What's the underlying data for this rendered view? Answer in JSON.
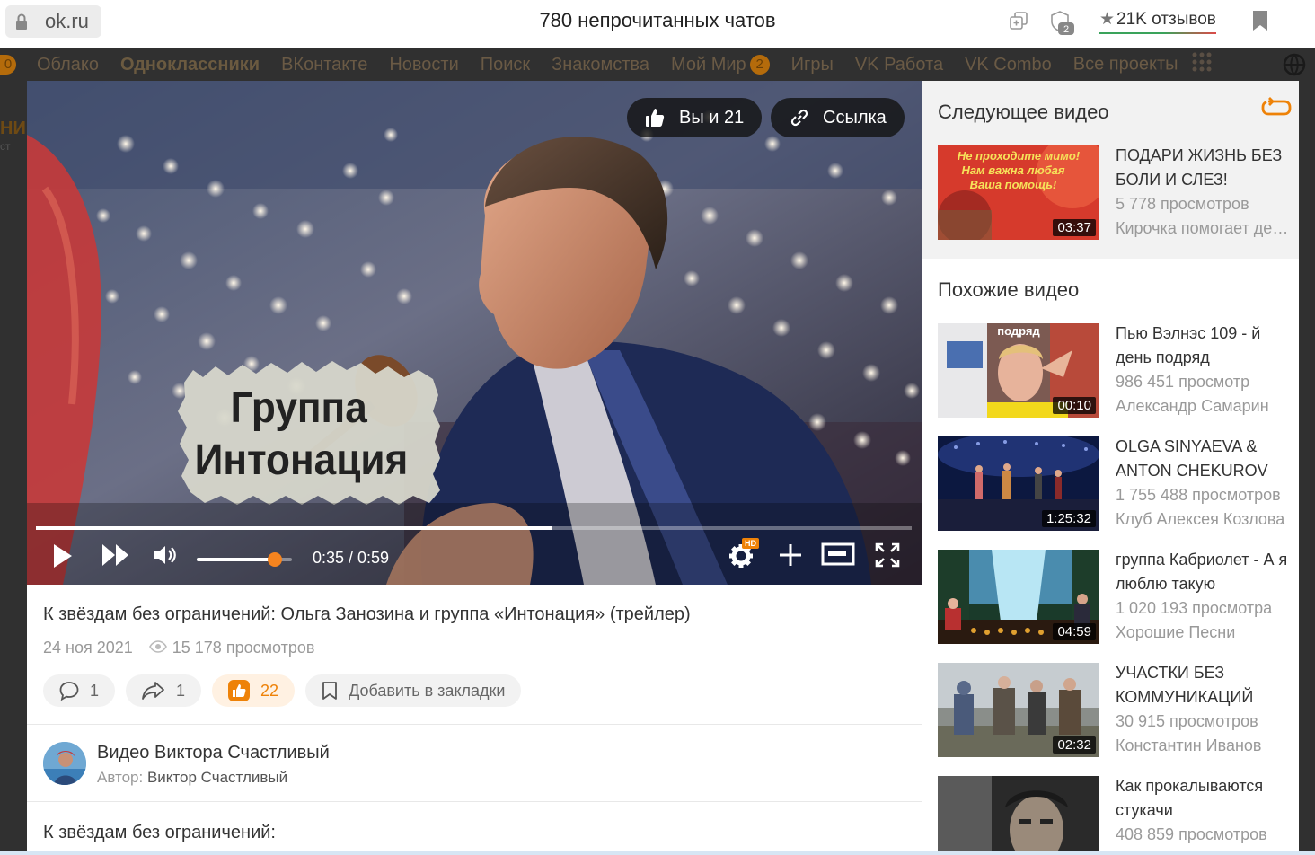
{
  "browser": {
    "url": "ok.ru",
    "title": "780 непрочитанных чатов",
    "badge_count": "2",
    "reviews": "21K отзывов"
  },
  "topnav": {
    "left_badge": "0",
    "items": [
      "Облако",
      "Одноклассники",
      "ВКонтакте",
      "Новости",
      "Поиск",
      "Знакомства",
      "Мой Мир",
      "Игры",
      "VK Работа",
      "VK Combo",
      "Все проекты"
    ],
    "moimir_badge": "2"
  },
  "background_page": {
    "fragment_1": "НИ",
    "fragment_2": "ст"
  },
  "player": {
    "like_label": "Вы и 21",
    "link_label": "Ссылка",
    "overlay_line1": "Группа",
    "overlay_line2": "Интонация",
    "time": "0:35 / 0:59",
    "progress": 0.59,
    "volume": 0.82,
    "hd": "HD"
  },
  "video": {
    "title": "К звёздам без ограничений: Ольга Занозина и группа «Интонация» (трейлер)",
    "date": "24 ноя 2021",
    "views": "15 178 просмотров",
    "comments": "1",
    "shares": "1",
    "likes": "22",
    "bookmark_label": "Добавить в закладки",
    "channel": "Видео Виктора Счастливый",
    "author_prefix": "Автор:",
    "author": "Виктор Счастливый",
    "description": "К звёздам без ограничений:"
  },
  "sidebar": {
    "next_title": "Следующее видео",
    "similar_title": "Похожие видео",
    "next": {
      "title_line1": "ПОДАРИ ЖИЗНЬ БЕЗ",
      "title_line2": "БОЛИ И СЛЕЗ!",
      "views": "5 778 просмотров",
      "author": "Кирочка помогает де…",
      "duration": "03:37",
      "thumb_text1": "Не проходите мимо!",
      "thumb_text2": "Нам важна любая",
      "thumb_text3": "Ваша помощь!"
    },
    "similar": [
      {
        "title_line1": "Пью Вэлнэс 109 - й",
        "title_line2": "день подряд",
        "views": "986 451 просмотр",
        "author": "Александр Самарин",
        "duration": "00:10",
        "thumb_text": "подряд"
      },
      {
        "title_line1": "OLGA SINYAEVA &",
        "title_line2": "ANTON CHEKUROV",
        "views": "1 755 488 просмотров",
        "author": "Клуб Алексея Козлова",
        "duration": "1:25:32"
      },
      {
        "title_line1": "группа Кабриолет - А я",
        "title_line2": "люблю такую",
        "views": "1 020 193 просмотра",
        "author": "Хорошие Песни",
        "duration": "04:59"
      },
      {
        "title_line1": "УЧАСТКИ БЕЗ",
        "title_line2": "КОММУНИКАЦИЙ",
        "views": "30 915 просмотров",
        "author": "Константин Иванов",
        "duration": "02:32"
      },
      {
        "title_line1": "Как прокалываются",
        "title_line2": "стукачи",
        "views": "408 859 просмотров",
        "author": "",
        "duration": ""
      }
    ]
  }
}
